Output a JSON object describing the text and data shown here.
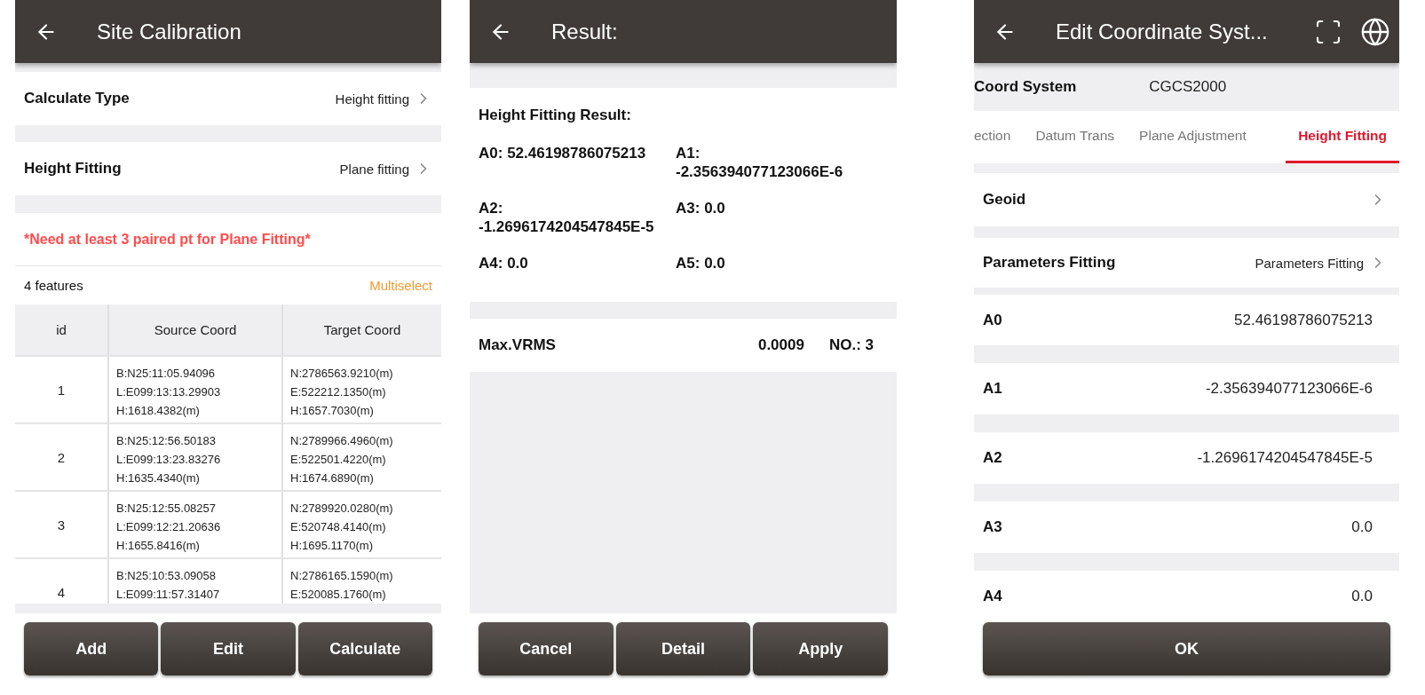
{
  "site_calibration": {
    "title": "Site Calibration",
    "settings": [
      {
        "label": "Calculate Type",
        "value": "Height fitting"
      },
      {
        "label": "Height Fitting",
        "value": "Plane fitting"
      }
    ],
    "warning": "*Need at least 3 paired pt for Plane Fitting*",
    "feature_count": "4 features",
    "multiselect": "Multiselect",
    "table": {
      "columns": [
        "id",
        "Source Coord",
        "Target Coord"
      ],
      "rows": [
        {
          "id": "1",
          "source": [
            "B:N25:11:05.94096",
            "L:E099:13:13.29903",
            "H:1618.4382(m)"
          ],
          "target": [
            "N:2786563.9210(m)",
            "E:522212.1350(m)",
            "H:1657.7030(m)"
          ]
        },
        {
          "id": "2",
          "source": [
            "B:N25:12:56.50183",
            "L:E099:13:23.83276",
            "H:1635.4340(m)"
          ],
          "target": [
            "N:2789966.4960(m)",
            "E:522501.4220(m)",
            "H:1674.6890(m)"
          ]
        },
        {
          "id": "3",
          "source": [
            "B:N25:12:55.08257",
            "L:E099:12:21.20636",
            "H:1655.8416(m)"
          ],
          "target": [
            "N:2789920.0280(m)",
            "E:520748.4140(m)",
            "H:1695.1170(m)"
          ]
        },
        {
          "id": "4",
          "source": [
            "B:N25:10:53.09058",
            "L:E099:11:57.31407"
          ],
          "target": [
            "N:2786165.1590(m)",
            "E:520085.1760(m)"
          ]
        }
      ]
    },
    "buttons": [
      "Add",
      "Edit",
      "Calculate"
    ]
  },
  "result": {
    "title": "Result:",
    "heading": "Height Fitting Result:",
    "parameters": [
      {
        "label": "A0:",
        "value": "52.46198786075213"
      },
      {
        "label": "A1:",
        "value": "-2.356394077123066E-6"
      },
      {
        "label": "A2:",
        "value": "-1.2696174204547845E-5"
      },
      {
        "label": "A3:",
        "value": "0.0"
      },
      {
        "label": "A4:",
        "value": "0.0"
      },
      {
        "label": "A5:",
        "value": "0.0"
      }
    ],
    "max_vrms": {
      "label": "Max.VRMS",
      "value": "0.0009",
      "count": "NO.: 3"
    },
    "buttons": [
      "Cancel",
      "Detail",
      "Apply"
    ]
  },
  "edit_coordinate_system": {
    "title": "Edit Coordinate Syst...",
    "coord_system": {
      "label": "Coord System",
      "value": "CGCS2000"
    },
    "tabs": [
      {
        "label": "ection",
        "selected": false
      },
      {
        "label": "Datum Trans",
        "selected": false
      },
      {
        "label": "Plane Adjustment",
        "selected": false
      },
      {
        "label": "Height Fitting",
        "selected": true
      }
    ],
    "links": [
      {
        "label": "Geoid"
      },
      {
        "label": "Parameters Fitting",
        "value": "Parameters Fitting"
      }
    ],
    "parameters": [
      {
        "label": "A0",
        "value": "52.46198786075213"
      },
      {
        "label": "A1",
        "value": "-2.356394077123066E-6"
      },
      {
        "label": "A2",
        "value": "-1.2696174204547845E-5"
      },
      {
        "label": "A3",
        "value": "0.0"
      },
      {
        "label": "A4",
        "value": "0.0"
      }
    ],
    "buttons": [
      "OK"
    ]
  }
}
